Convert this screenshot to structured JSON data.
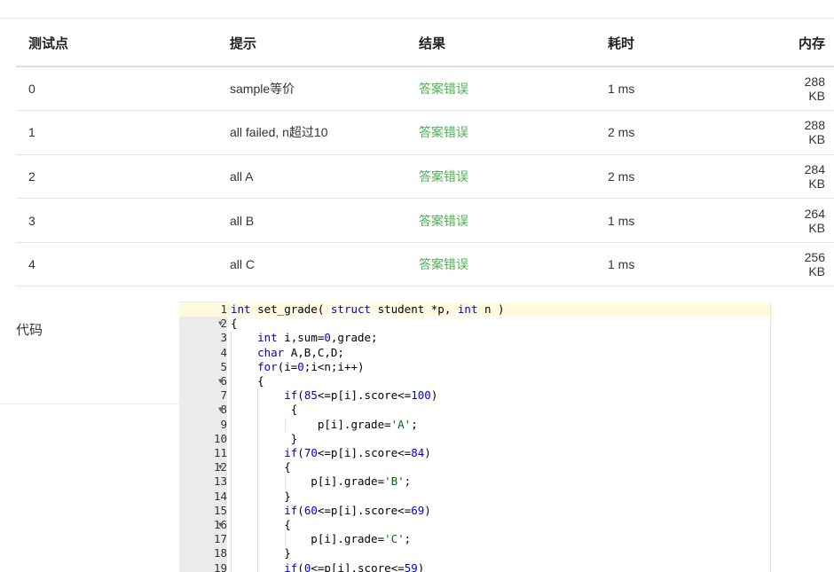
{
  "results_table": {
    "headers": [
      "测试点",
      "提示",
      "结果",
      "耗时",
      "内存"
    ],
    "rows": [
      {
        "case": "0",
        "hint": "sample等价",
        "result": "答案错误",
        "time": "1 ms",
        "memory": "288 KB"
      },
      {
        "case": "1",
        "hint": "all failed, n超过10",
        "result": "答案错误",
        "time": "2 ms",
        "memory": "288 KB"
      },
      {
        "case": "2",
        "hint": "all A",
        "result": "答案错误",
        "time": "2 ms",
        "memory": "284 KB"
      },
      {
        "case": "3",
        "hint": "all B",
        "result": "答案错误",
        "time": "1 ms",
        "memory": "264 KB"
      },
      {
        "case": "4",
        "hint": "all C",
        "result": "答案错误",
        "time": "1 ms",
        "memory": "256 KB"
      }
    ]
  },
  "code_section": {
    "label": "代码",
    "lines": [
      "int set_grade( struct student *p, int n )",
      "{",
      "    int i,sum=0,grade;",
      "    char A,B,C,D;",
      "    for(i=0;i<n;i++)",
      "    {",
      "        if(85<=p[i].score<=100)",
      "         {",
      "             p[i].grade='A';",
      "         }",
      "        if(70<=p[i].score<=84)",
      "        {",
      "            p[i].grade='B';",
      "        }",
      "        if(60<=p[i].score<=69)",
      "        {",
      "            p[i].grade='C';",
      "        }",
      "        if(0<=p[i].score<=59)"
    ],
    "fold_lines": [
      2,
      6,
      8,
      12,
      16
    ]
  },
  "colors": {
    "result_error": "#4caf50",
    "keyword": "#0000cc",
    "string": "#036a07",
    "gutter": "#ebebeb"
  }
}
